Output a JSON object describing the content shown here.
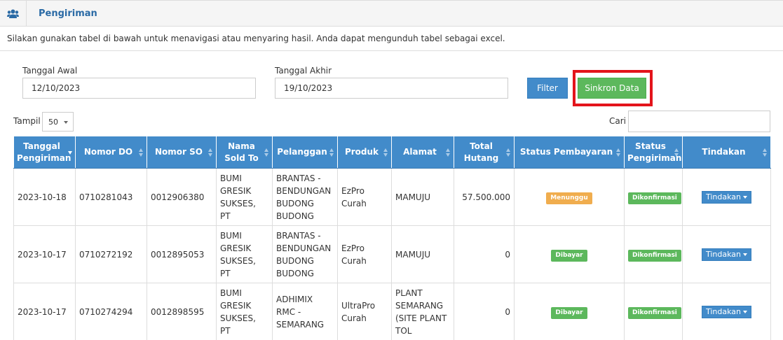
{
  "header": {
    "title": "Pengiriman",
    "icon": "users-icon"
  },
  "info": "Silakan gunakan tabel di bawah untuk menavigasi atau menyaring hasil. Anda dapat mengunduh tabel sebagai excel.",
  "filters": {
    "start_label": "Tanggal Awal",
    "start_value": "12/10/2023",
    "end_label": "Tanggal Akhir",
    "end_value": "19/10/2023",
    "filter_button": "Filter",
    "sync_button": "Sinkron Data"
  },
  "table_controls": {
    "show_label": "Tampil",
    "show_value": "50",
    "search_label": "Cari"
  },
  "table": {
    "headers": [
      "Tanggal Pengiriman",
      "Nomor DO",
      "Nomor SO",
      "Nama Sold To",
      "Pelanggan",
      "Produk",
      "Alamat",
      "Total Hutang",
      "Status Pembayaran",
      "Status Pengiriman",
      "Tindakan"
    ],
    "rows": [
      {
        "tanggal": "2023-10-18",
        "do": "0710281043",
        "so": "0012906380",
        "sold_to": "BUMI GRESIK SUKSES, PT",
        "pelanggan": "BRANTAS - BENDUNGAN BUDONG BUDONG",
        "produk": "EzPro Curah",
        "alamat": "MAMUJU",
        "hutang": "57.500.000",
        "status_bayar": "Menunggu",
        "status_kirim": "Dikonfirmasi",
        "aksi": "Tindakan"
      },
      {
        "tanggal": "2023-10-17",
        "do": "0710272192",
        "so": "0012895053",
        "sold_to": "BUMI GRESIK SUKSES, PT",
        "pelanggan": "BRANTAS - BENDUNGAN BUDONG BUDONG",
        "produk": "EzPro Curah",
        "alamat": "MAMUJU",
        "hutang": "0",
        "status_bayar": "Dibayar",
        "status_kirim": "Dikonfirmasi",
        "aksi": "Tindakan"
      },
      {
        "tanggal": "2023-10-17",
        "do": "0710274294",
        "so": "0012898595",
        "sold_to": "BUMI GRESIK SUKSES, PT",
        "pelanggan": "ADHIMIX RMC - SEMARANG",
        "produk": "UltraPro Curah",
        "alamat": "PLANT SEMARANG (SITE PLANT TOL",
        "hutang": "0",
        "status_bayar": "Dibayar",
        "status_kirim": "Dikonfirmasi",
        "aksi": "Tindakan"
      }
    ]
  },
  "colors": {
    "primary": "#428bca",
    "success": "#5cb85c",
    "warning": "#f0ad4e",
    "highlight": "#e3141b"
  }
}
